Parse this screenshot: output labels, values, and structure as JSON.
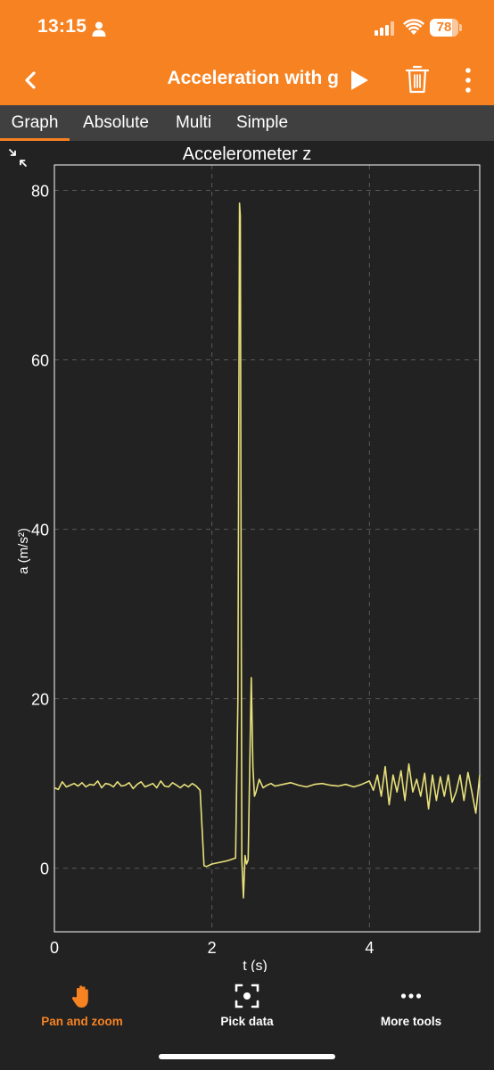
{
  "status_bar": {
    "time": "13:15",
    "battery": "78",
    "battery_level_percent": 78
  },
  "app_bar": {
    "title": "Acceleration with g",
    "icons": [
      "back-chevron-icon",
      "play-icon",
      "trash-icon",
      "more-vert-icon"
    ]
  },
  "tabs": [
    {
      "label": "Graph",
      "active": true
    },
    {
      "label": "Absolute",
      "active": false
    },
    {
      "label": "Multi",
      "active": false
    },
    {
      "label": "Simple",
      "active": false
    }
  ],
  "bottom_nav": [
    {
      "label": "Pan and zoom",
      "icon": "hand-icon",
      "active": true
    },
    {
      "label": "Pick data",
      "icon": "crosshair-icon",
      "active": false
    },
    {
      "label": "More tools",
      "icon": "more-horiz-icon",
      "active": false
    }
  ],
  "colors": {
    "accent": "#f78222",
    "background": "#222222",
    "tabbar": "#404040",
    "line": "#e8e07a"
  },
  "chart_data": {
    "type": "line",
    "title": "Accelerometer z",
    "xlabel": "t (s)",
    "ylabel": "a (m/s²)",
    "xlim": [
      0,
      5.4
    ],
    "ylim": [
      -7.5,
      83
    ],
    "xticks": [
      0,
      2,
      4
    ],
    "yticks": [
      0,
      20,
      40,
      60,
      80
    ],
    "grid": true,
    "series": [
      {
        "x": [
          0.0,
          0.05,
          0.1,
          0.15,
          0.2,
          0.25,
          0.3,
          0.35,
          0.4,
          0.45,
          0.5,
          0.55,
          0.6,
          0.65,
          0.7,
          0.75,
          0.8,
          0.85,
          0.9,
          0.95,
          1.0,
          1.05,
          1.1,
          1.15,
          1.2,
          1.25,
          1.3,
          1.35,
          1.4,
          1.45,
          1.5,
          1.55,
          1.6,
          1.65,
          1.7,
          1.75,
          1.8,
          1.85,
          1.9,
          1.93,
          2.0,
          2.1,
          2.2,
          2.3,
          2.33,
          2.35,
          2.36,
          2.38,
          2.4,
          2.42,
          2.44,
          2.46,
          2.5,
          2.52,
          2.54,
          2.56,
          2.6,
          2.65,
          2.7,
          2.75,
          2.8,
          2.9,
          3.0,
          3.1,
          3.2,
          3.3,
          3.4,
          3.5,
          3.6,
          3.7,
          3.8,
          3.9,
          4.0,
          4.05,
          4.1,
          4.15,
          4.2,
          4.25,
          4.3,
          4.35,
          4.4,
          4.45,
          4.5,
          4.55,
          4.6,
          4.65,
          4.7,
          4.75,
          4.8,
          4.85,
          4.9,
          4.95,
          5.0,
          5.05,
          5.1,
          5.15,
          5.2,
          5.25,
          5.3,
          5.35,
          5.4
        ],
        "y": [
          9.5,
          9.3,
          10.2,
          9.6,
          9.8,
          10.0,
          9.7,
          10.1,
          9.6,
          9.9,
          9.8,
          10.3,
          9.5,
          10.0,
          9.9,
          9.6,
          10.2,
          9.7,
          9.8,
          10.1,
          9.4,
          9.9,
          10.2,
          9.6,
          9.8,
          10.0,
          9.5,
          10.3,
          9.7,
          9.6,
          10.1,
          9.8,
          9.5,
          9.9,
          9.6,
          10.0,
          9.7,
          9.2,
          0.3,
          0.2,
          0.5,
          0.7,
          0.9,
          1.2,
          20.0,
          78.5,
          77.0,
          1.0,
          -3.5,
          1.5,
          0.5,
          1.0,
          22.5,
          12.0,
          8.5,
          9.0,
          10.5,
          9.5,
          9.8,
          10.0,
          9.7,
          9.9,
          10.1,
          9.8,
          9.6,
          9.9,
          10.0,
          9.8,
          9.7,
          9.9,
          9.6,
          9.9,
          10.3,
          9.2,
          11.0,
          8.5,
          12.0,
          7.5,
          11.0,
          9.0,
          11.5,
          8.0,
          12.3,
          9.0,
          10.5,
          8.5,
          11.2,
          7.0,
          11.0,
          8.0,
          10.8,
          8.5,
          11.0,
          7.8,
          9.0,
          11.0,
          8.0,
          11.3,
          9.0,
          6.5,
          11.0
        ]
      }
    ]
  }
}
